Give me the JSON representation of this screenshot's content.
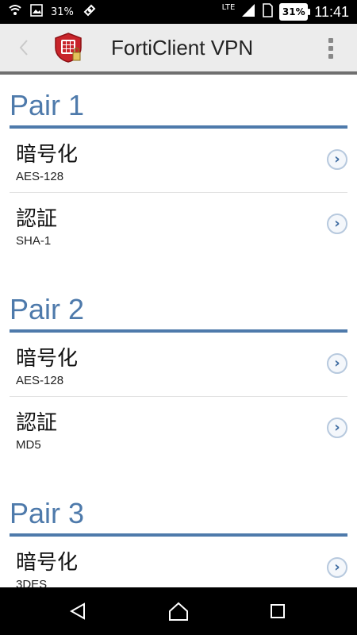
{
  "status_bar": {
    "battery_small": "31%",
    "network": "LTE",
    "battery_badge": "31%",
    "time": "11:41"
  },
  "app_bar": {
    "title": "FortiClient VPN",
    "icons": {
      "back": "chevron-left-icon",
      "logo": "forticlient-logo",
      "menu": "overflow-menu-icon"
    }
  },
  "sections": [
    {
      "title": "Pair 1",
      "rows": [
        {
          "label": "暗号化",
          "value": "AES-128"
        },
        {
          "label": "認証",
          "value": "SHA-1"
        }
      ]
    },
    {
      "title": "Pair 2",
      "rows": [
        {
          "label": "暗号化",
          "value": "AES-128"
        },
        {
          "label": "認証",
          "value": "MD5"
        }
      ]
    },
    {
      "title": "Pair 3",
      "rows": [
        {
          "label": "暗号化",
          "value": "3DES"
        }
      ]
    }
  ],
  "nav_bar": {
    "icons": [
      "back-triangle-icon",
      "home-icon",
      "recents-square-icon"
    ]
  },
  "colors": {
    "accent": "#4e7aab",
    "appbar_bg": "#ececec",
    "status_bg": "#000000"
  }
}
